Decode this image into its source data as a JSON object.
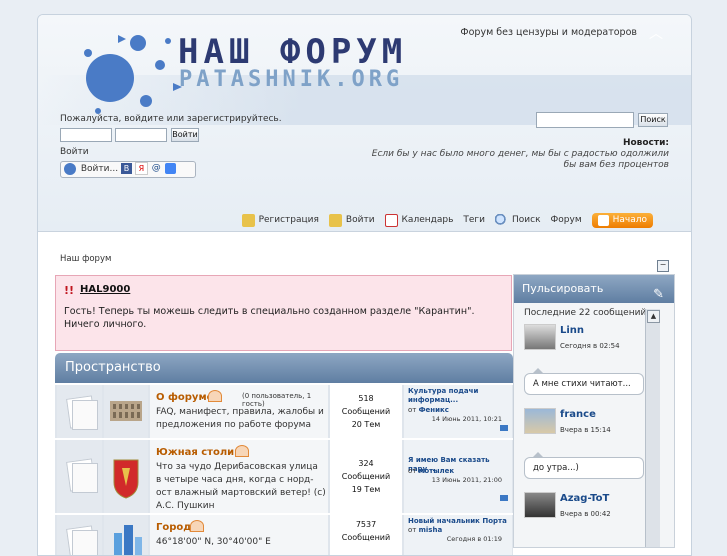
{
  "header": {
    "logo_title": "НАШ ФОРУМ",
    "logo_subtitle": "PATASHNIK.ORG",
    "slogan": "Форум без цензуры и модераторов",
    "login_prompt": "Пожалуйста, войдите или зарегистрируйтесь.",
    "login_button": "Войти",
    "enter_link": "Войти",
    "social_label": "Войти...",
    "search_button": "Поиск",
    "news_title": "Новости:",
    "news_text": "Если бы у нас было много денег, мы бы с радостью одолжили бы вам без процентов"
  },
  "nav": [
    {
      "label": "Регистрация",
      "icon": "key-icon"
    },
    {
      "label": "Войти",
      "icon": "key-icon"
    },
    {
      "label": "Календарь",
      "icon": "calendar-icon"
    },
    {
      "label": "Теги",
      "icon": ""
    },
    {
      "label": "Поиск",
      "icon": "search-icon"
    },
    {
      "label": "Форум",
      "icon": ""
    },
    {
      "label": "Начало",
      "icon": "home-icon"
    }
  ],
  "breadcrumb": "Наш форум",
  "notice": {
    "marker": "!!",
    "title": "HAL9000",
    "body": "Гость! Теперь ты можешь следить в специально созданном разделе \"Карантин\". Ничего личного."
  },
  "category": {
    "title": "Пространство",
    "forums": [
      {
        "title": "О форуме",
        "moderators": "(0 пользователь, 1 гость)",
        "description": "FAQ, манифест, правила, жалобы и предложения по работе форума",
        "posts": "518",
        "posts_label": "Сообщений",
        "topics": "20 Тем",
        "last_title": "Культура подачи информац...",
        "last_by_prefix": "от",
        "last_by": "Феникс",
        "last_date": "14 Июнь 2011, 10:21"
      },
      {
        "title": "Южная столица",
        "moderators": "",
        "description": "Что за чудо Дерибасовская улица в четыре часа дня, когда с норд-ост влажный мартовский ветер! (с) А.С. Пушкин",
        "posts": "324",
        "posts_label": "Сообщений",
        "topics": "19 Тем",
        "last_title": "Я имею Вам сказать пару ...",
        "last_by_prefix": "от",
        "last_by": "мотылек",
        "last_date": "13 Июнь 2011, 21:00"
      },
      {
        "title": "Город",
        "moderators": "",
        "description": "46°18'00\" N, 30°40'00\" E",
        "posts": "7537",
        "posts_label": "Сообщений",
        "topics": "",
        "last_title": "Новый начальник Порта",
        "last_by_prefix": "от",
        "last_by": "misha",
        "last_date": "Сегодня в 01:19"
      }
    ]
  },
  "sidebar": {
    "title": "Пульсировать",
    "info": "Последние 22 сообщений:",
    "entries": [
      {
        "name": "Linn",
        "time": "Сегодня в 02:54",
        "message": "А мне стихи читают..."
      },
      {
        "name": "france",
        "time": "Вчера в 15:14",
        "message": "до утра...)"
      },
      {
        "name": "Azag-ToT",
        "time": "Вчера в 00:42",
        "message": ""
      }
    ]
  },
  "colors": {
    "accent_orange": "#ee7c00",
    "category_blue": "#5f7ea2",
    "notice_bg": "#fce4ea",
    "link_blue": "#1a4a8a"
  }
}
